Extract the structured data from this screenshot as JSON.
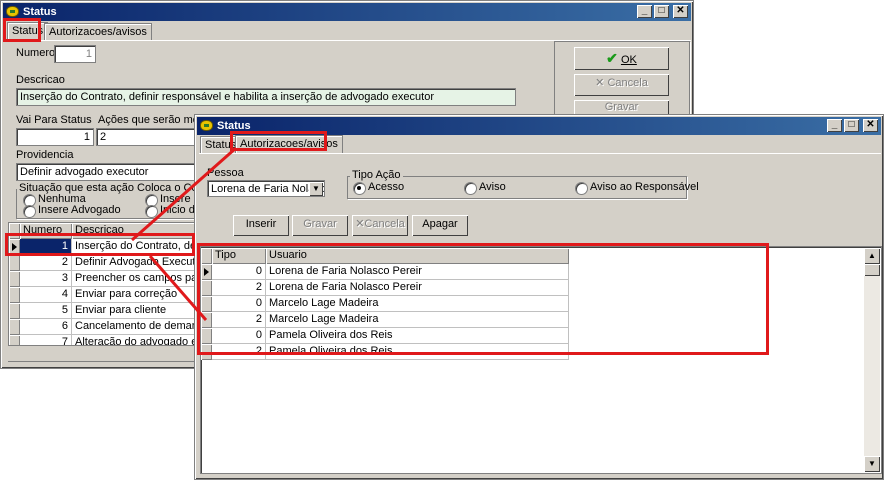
{
  "back_window": {
    "title": "Status",
    "controls": {
      "minimize": "_",
      "maximize": "□",
      "close": "✕"
    },
    "tabs": [
      "Status",
      "Autorizacoes/avisos"
    ],
    "numero_label": "Numero",
    "numero_value": "1",
    "descricao_label": "Descricao",
    "descricao_value": "Inserção do Contrato, definir responsável e habilita a inserção de advogado executor",
    "vai_para_label": "Vai Para Status",
    "vai_para_value": "1",
    "acoes_label": "Ações que serão mostradas",
    "acoes_value": "2",
    "providencia_label": "Providencia",
    "providencia_value": "Definir advogado executor",
    "situacao_label": "Situação que esta ação Coloca o Contrato",
    "situacao_options": [
      "Nenhuma",
      "Insere Advogado",
      "Insere C",
      "Inicio da"
    ],
    "buttons": {
      "ok": "OK",
      "cancela": "Cancela",
      "gravar": "Gravar"
    },
    "grid": {
      "headers": [
        "Numero",
        "Descricao"
      ],
      "rows": [
        {
          "numero": "1",
          "descricao": "Inserção do Contrato, definir"
        },
        {
          "numero": "2",
          "descricao": "Definir Advogado Executor"
        },
        {
          "numero": "3",
          "descricao": "Preencher os campos para in"
        },
        {
          "numero": "4",
          "descricao": "Enviar para correção"
        },
        {
          "numero": "5",
          "descricao": "Enviar para cliente"
        },
        {
          "numero": "6",
          "descricao": "Cancelamento de demanda"
        },
        {
          "numero": "7",
          "descricao": "Alteração do advogado execu"
        }
      ]
    }
  },
  "front_window": {
    "title": "Status",
    "controls": {
      "minimize": "_",
      "maximize": "□",
      "close": "✕"
    },
    "tabs": [
      "Status",
      "Autorizacoes/avisos"
    ],
    "pessoa_label": "Pessoa",
    "pessoa_value": "Lorena de Faria Nolasco F",
    "tipo_acao_label": "Tipo Ação",
    "tipo_acao_options": [
      "Acesso",
      "Aviso",
      "Aviso ao Responsável"
    ],
    "tipo_acao_selected": "Acesso",
    "buttons": {
      "inserir": "Inserir",
      "gravar": "Gravar",
      "cancela": "Cancela",
      "apagar": "Apagar"
    },
    "grid": {
      "headers": [
        "Tipo",
        "Usuario"
      ],
      "rows": [
        {
          "tipo": "0",
          "usuario": "Lorena de Faria Nolasco Pereir"
        },
        {
          "tipo": "2",
          "usuario": "Lorena de Faria Nolasco Pereir"
        },
        {
          "tipo": "0",
          "usuario": "Marcelo Lage Madeira"
        },
        {
          "tipo": "2",
          "usuario": "Marcelo Lage Madeira"
        },
        {
          "tipo": "0",
          "usuario": "Pamela Oliveira dos Reis"
        },
        {
          "tipo": "2",
          "usuario": "Pamela Oliveira dos Reis"
        }
      ]
    }
  },
  "colors": {
    "highlight_red": "#e0191b",
    "title_blue": "#0a246a",
    "selection_navy": "#0a246a",
    "ok_check_green": "#1a9a1a"
  }
}
